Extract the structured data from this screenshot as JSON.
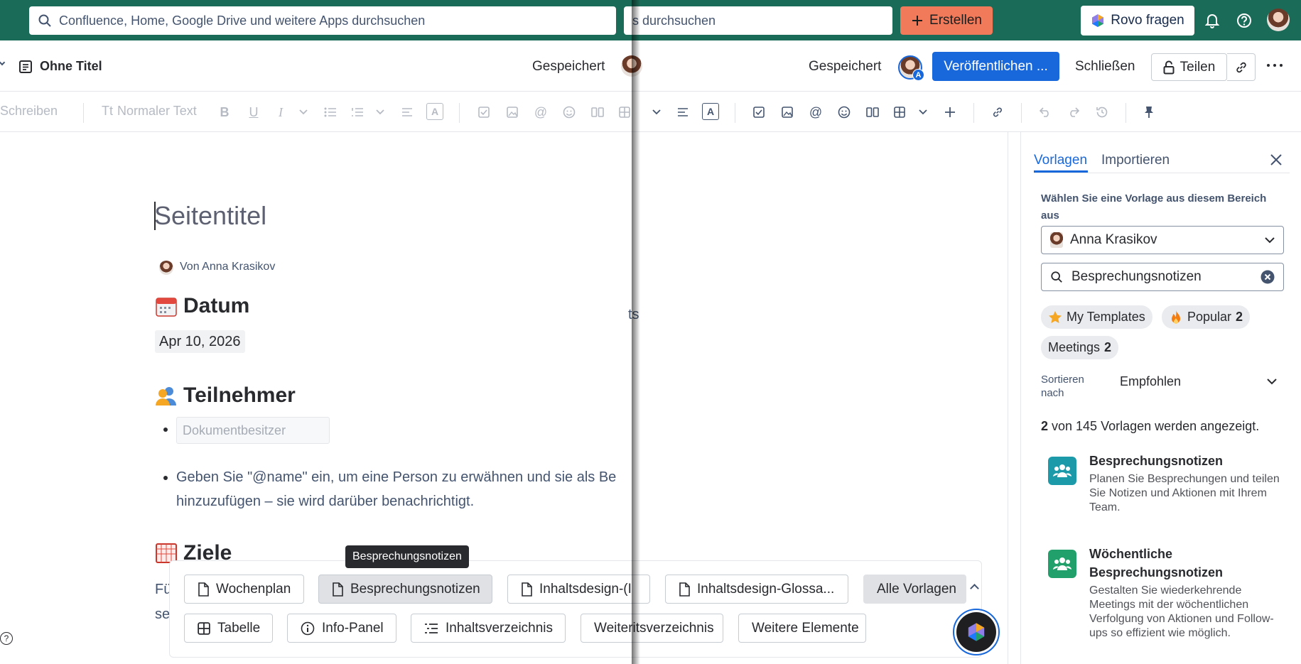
{
  "topbar": {
    "search_placeholder": "Confluence, Home, Google Drive und weitere Apps durchsuchen",
    "search_fragment": "s durchsuchen",
    "create_label": "Erstellen",
    "rovo_label": "Rovo fragen"
  },
  "header": {
    "page_name": "Ohne Titel",
    "saved_left": "Gespeichert",
    "saved_right": "Gespeichert",
    "publish_label": "Veröffentlichen ...",
    "close_label": "Schließen",
    "share_label": "Teilen",
    "avatar_badge": "A"
  },
  "toolbar": {
    "write_label": "Schreiben",
    "text_style_label": "Normaler Text",
    "tt_glyph": "Tt"
  },
  "document": {
    "title_placeholder": "Seitentitel",
    "author": "Von Anna Krasikov",
    "sections": {
      "date_heading": "Datum",
      "date_value": "Apr 10, 2026",
      "participants_heading": "Teilnehmer",
      "owner_placeholder": "Dokumentbesitzer",
      "mention_line1": "Geben Sie \"@name\" ein, um eine Person zu erwähnen und sie als Be",
      "mention_line2": "hinzuzufügen – sie wird darüber benachrichtigt.",
      "goals_heading": "Ziele",
      "cut_text_ts": "ts",
      "cut_text_fu": "Fü",
      "cut_text_se": "se"
    }
  },
  "template_bar": {
    "tooltip": "Besprechungsnotizen",
    "row1": [
      "Wochenplan",
      "Besprechungsnotizen",
      "Inhaltsdesign-(I",
      "Inhaltsdesign-Glossa...",
      "Alle Vorlagen"
    ],
    "row2": [
      "Tabelle",
      "Info-Panel",
      "Inhaltsverzeichnis",
      "Weiteritsverzeichnis",
      "Weitere Elemente"
    ]
  },
  "panel": {
    "tab_templates": "Vorlagen",
    "tab_import": "Importieren",
    "select_heading": "Wählen Sie eine Vorlage aus diesem Bereich aus",
    "space_value": "Anna Krasikov",
    "search_value": "Besprechungsnotizen",
    "tags": [
      {
        "label": "My Templates",
        "count": ""
      },
      {
        "label": "Popular",
        "count": "2"
      },
      {
        "label": "Meetings",
        "count": "2"
      }
    ],
    "sort_label": "Sortieren nach",
    "sort_value": "Empfohlen",
    "result_count": "2",
    "result_text": "von 145 Vorlagen werden angezeigt.",
    "templates": [
      {
        "title": "Besprechungsnotizen",
        "desc_lines": [
          "Planen Sie Besprechungen und teilen",
          "Sie Notizen und Aktionen mit Ihrem",
          "Team."
        ],
        "color": "#1d9aaa"
      },
      {
        "title_lines": [
          "Wöchentliche",
          "Besprechungsnotizen"
        ],
        "desc_lines": [
          "Gestalten Sie wiederkehrende",
          "Meetings mit der wöchentlichen",
          "Verfolgung von Aktionen und Follow-",
          "ups so effizient wie möglich."
        ],
        "color": "#22a06b"
      }
    ]
  },
  "colors": {
    "topbar": "#1a6b57",
    "create": "#f07a5a",
    "publish": "#1868db",
    "link_active": "#1868db"
  }
}
